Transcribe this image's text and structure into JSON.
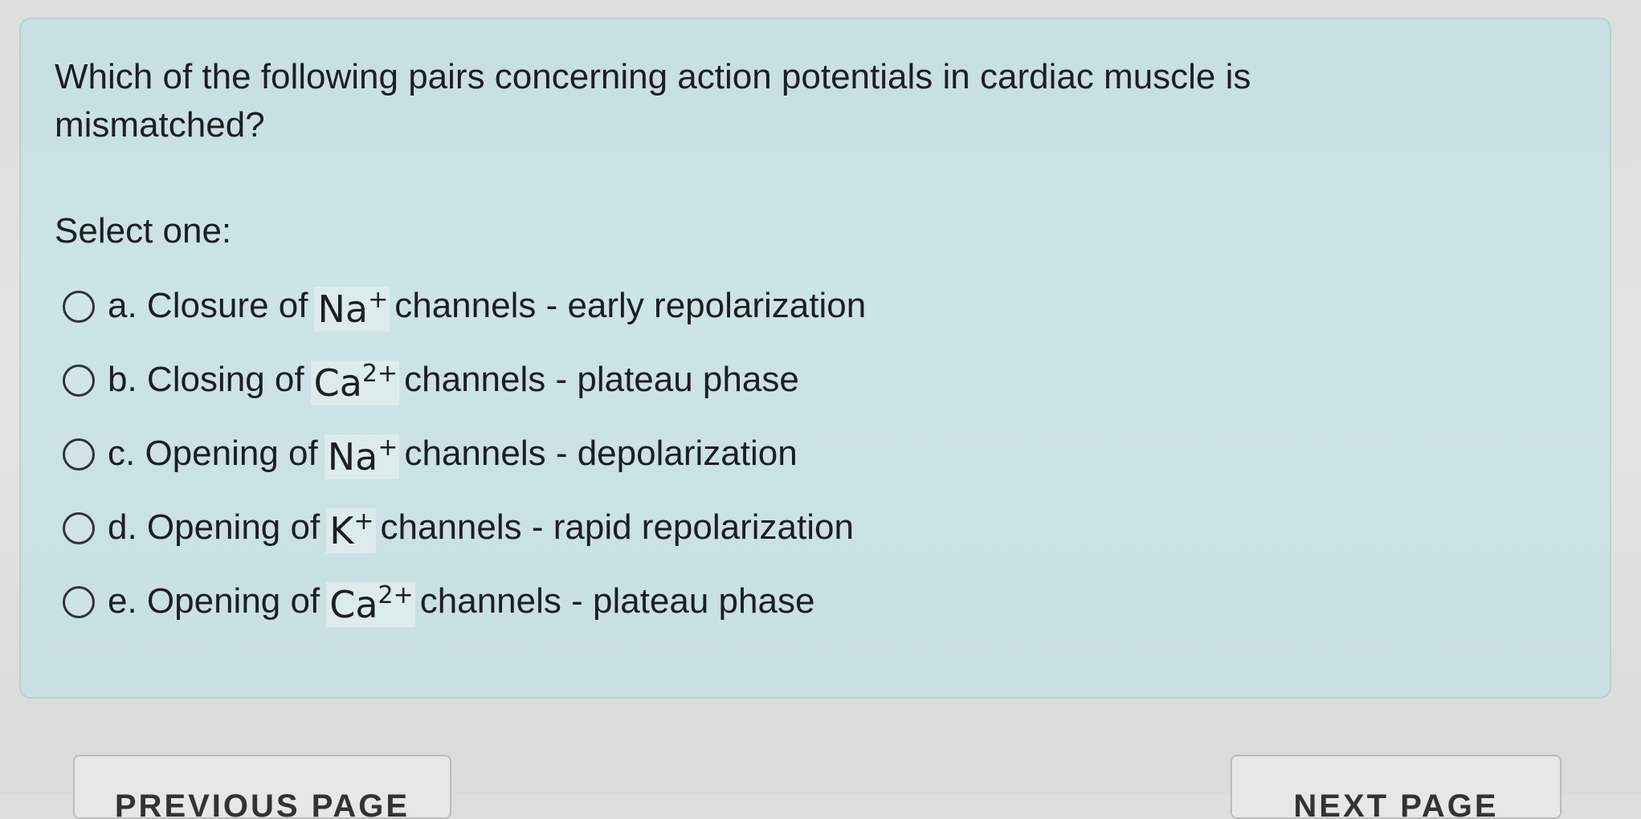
{
  "question": {
    "text": "Which of the following pairs concerning action potentials in cardiac muscle is mismatched?",
    "instruction": "Select one:",
    "options": [
      {
        "prefix": "a. Closure of",
        "ion": "Na",
        "charge": "+",
        "suffix": "channels - early repolarization"
      },
      {
        "prefix": "b. Closing of",
        "ion": "Ca",
        "charge": "2+",
        "suffix": "channels - plateau phase"
      },
      {
        "prefix": "c. Opening of",
        "ion": "Na",
        "charge": "+",
        "suffix": "channels - depolarization"
      },
      {
        "prefix": "d. Opening of",
        "ion": "K",
        "charge": "+",
        "suffix": "channels - rapid repolarization"
      },
      {
        "prefix": "e. Opening of",
        "ion": "Ca",
        "charge": "2+",
        "suffix": "channels - plateau phase"
      }
    ]
  },
  "navigation": {
    "previous_label": "PREVIOUS PAGE",
    "next_label": "NEXT PAGE"
  },
  "colors": {
    "card_background": "#c9e0e3",
    "page_background": "#dfe1de"
  }
}
